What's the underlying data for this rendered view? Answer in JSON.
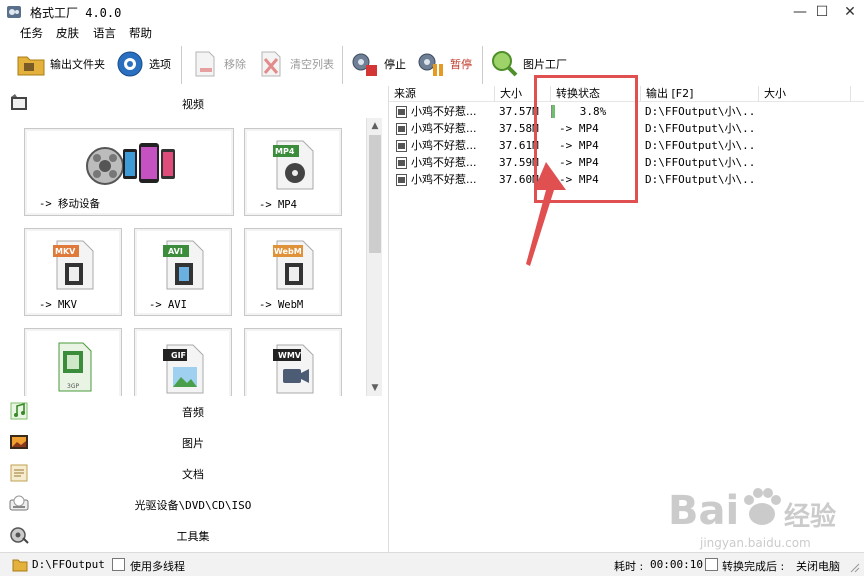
{
  "window": {
    "title": "格式工厂 4.0.0",
    "controls": [
      "—",
      "☐",
      "✕"
    ]
  },
  "menu": [
    "任务",
    "皮肤",
    "语言",
    "帮助"
  ],
  "toolbar": {
    "output_folder": "输出文件夹",
    "options": "选项",
    "remove": "移除",
    "clear_list": "清空列表",
    "stop": "停止",
    "pause": "暂停",
    "picture_factory": "图片工厂"
  },
  "left": {
    "categories": {
      "video": "视频",
      "audio": "音频",
      "picture": "图片",
      "document": "文档",
      "disc": "光驱设备\\DVD\\CD\\ISO",
      "tools": "工具集"
    },
    "tiles": [
      {
        "label": "-> 移动设备"
      },
      {
        "label": "-> MP4",
        "badge": "MP4"
      },
      {
        "label": "-> MKV",
        "badge": "MKV"
      },
      {
        "label": "-> AVI",
        "badge": "AVI"
      },
      {
        "label": "-> WebM",
        "badge": "WebM"
      },
      {
        "label": "",
        "badge": "3GP"
      },
      {
        "label": "",
        "badge": "GIF"
      },
      {
        "label": "",
        "badge": "WMV"
      }
    ]
  },
  "list": {
    "columns": [
      "来源",
      "大小",
      "转换状态",
      "输出 [F2]",
      "大小"
    ],
    "rows": [
      {
        "source": "小鸡不好惹...",
        "size": "37.57M",
        "status": "3.8%",
        "progress": 0.038,
        "output": "D:\\FFOutput\\小\\..."
      },
      {
        "source": "小鸡不好惹...",
        "size": "37.58M",
        "status": "-> MP4",
        "output": "D:\\FFOutput\\小\\..."
      },
      {
        "source": "小鸡不好惹...",
        "size": "37.61M",
        "status": "-> MP4",
        "output": "D:\\FFOutput\\小\\..."
      },
      {
        "source": "小鸡不好惹...",
        "size": "37.59M",
        "status": "-> MP4",
        "output": "D:\\FFOutput\\小\\..."
      },
      {
        "source": "小鸡不好惹...",
        "size": "37.60M",
        "status": "-> MP4",
        "output": "D:\\FFOutput\\小\\..."
      }
    ]
  },
  "status_bar": {
    "output_path": "D:\\FFOutput",
    "multithread": "使用多线程",
    "elapsed_label": "耗时 :",
    "elapsed": "00:00:10",
    "after_done_label": "转换完成后 :",
    "after_done": "关闭电脑"
  },
  "watermark": {
    "brand": "Bai",
    "brand_suffix": "经验",
    "url": "jingyan.baidu.com"
  },
  "colors": {
    "annotation": "#e05050",
    "accent_blue": "#1e6fd0"
  }
}
